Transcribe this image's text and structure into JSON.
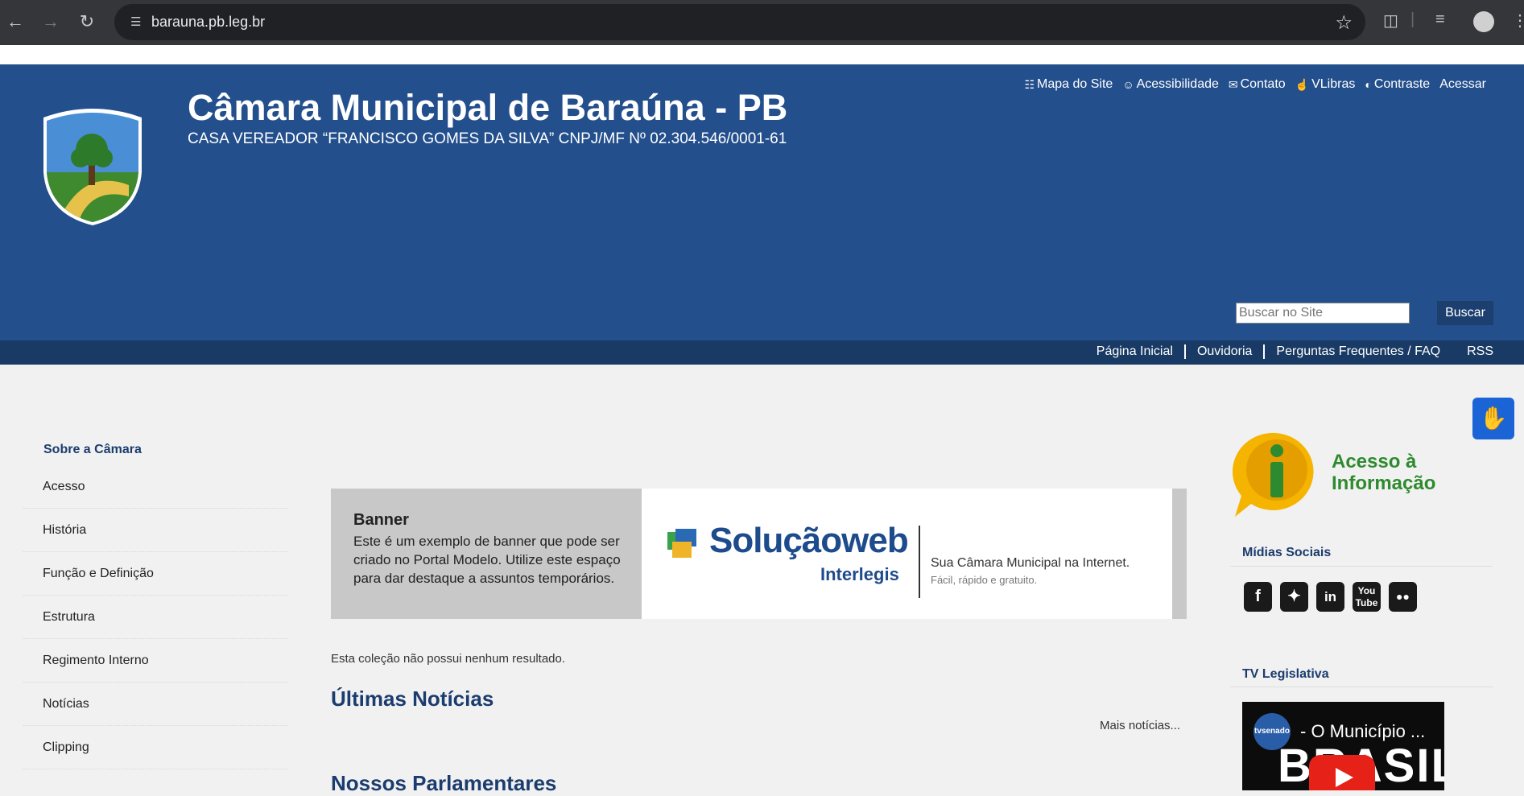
{
  "browser": {
    "url": "barauna.pb.leg.br"
  },
  "header": {
    "title": "Câmara Municipal de Baraúna - PB",
    "subtitle": "CASA VEREADOR “FRANCISCO GOMES DA SILVA” CNPJ/MF Nº 02.304.546/0001-61",
    "toplinks": {
      "sitemap": "Mapa do Site",
      "accessibility": "Acessibilidade",
      "contact": "Contato",
      "vlibras": "VLibras",
      "contrast": "Contraste",
      "login": "Acessar"
    },
    "search_placeholder": "Buscar no Site",
    "search_button": "Buscar"
  },
  "navbar": {
    "home": "Página Inicial",
    "ombudsman": "Ouvidoria",
    "faq": "Perguntas Frequentes / FAQ",
    "rss": "RSS"
  },
  "sidebar": {
    "title": "Sobre a Câmara",
    "items": [
      "Acesso",
      "História",
      "Função e Definição",
      "Estrutura",
      "Regimento Interno",
      "Notícias",
      "Clipping"
    ]
  },
  "banner": {
    "title": "Banner",
    "text": "Este é um exemplo de banner que pode ser criado no Portal Modelo. Utilize este espaço para dar destaque a assuntos temporários.",
    "brand": "Soluçãoweb",
    "brand_sub": "Interlegis",
    "tagline": "Sua Câmara Municipal na Internet.",
    "tagline2": "Fácil, rápido e gratuito."
  },
  "main": {
    "empty_message": "Esta coleção não possui nenhum resultado.",
    "news_heading": "Últimas Notícias",
    "more_news": "Mais notícias...",
    "parliamentarians_heading": "Nossos Parlamentares"
  },
  "right": {
    "info_text_1": "Acesso à",
    "info_text_2": "Informação",
    "social_title": "Mídias Sociais",
    "social_icons": [
      "facebook-icon",
      "twitter-icon",
      "linkedin-icon",
      "youtube-icon",
      "flickr-icon"
    ],
    "tv_title": "TV Legislativa",
    "video_title": "- O Município ...",
    "video_channel": "tvsenado",
    "video_overlay": "BRASIL"
  },
  "colors": {
    "header_blue": "#234f8c",
    "nav_blue": "#193a64",
    "heading_blue": "#1b3c6e",
    "info_green": "#2e8a2e"
  }
}
